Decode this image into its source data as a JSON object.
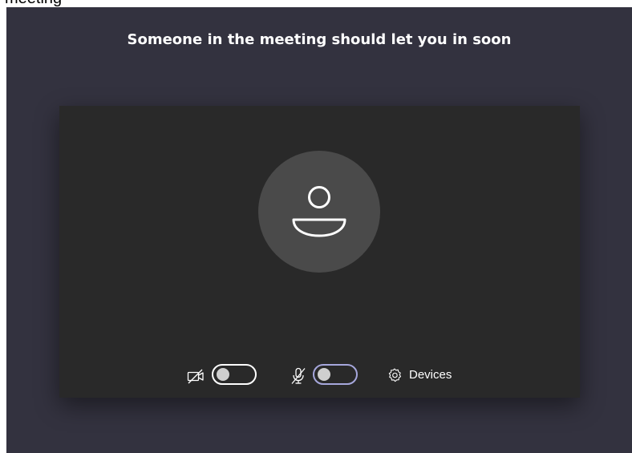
{
  "page_above": {
    "clipped_text": "meeting"
  },
  "lobby": {
    "title": "Someone in the meeting should let you in soon"
  },
  "controls": {
    "camera": {
      "icon": "camera-off-icon",
      "on": false
    },
    "microphone": {
      "icon": "mic-off-icon",
      "on": false
    },
    "devices": {
      "icon": "gear-icon",
      "label": "Devices"
    }
  },
  "colors": {
    "stage_bg": "#33323f",
    "preview_bg": "#292929",
    "avatar_bg": "#4a4a4a",
    "focus_ring": "#a6a7dc",
    "text": "#ffffff"
  }
}
